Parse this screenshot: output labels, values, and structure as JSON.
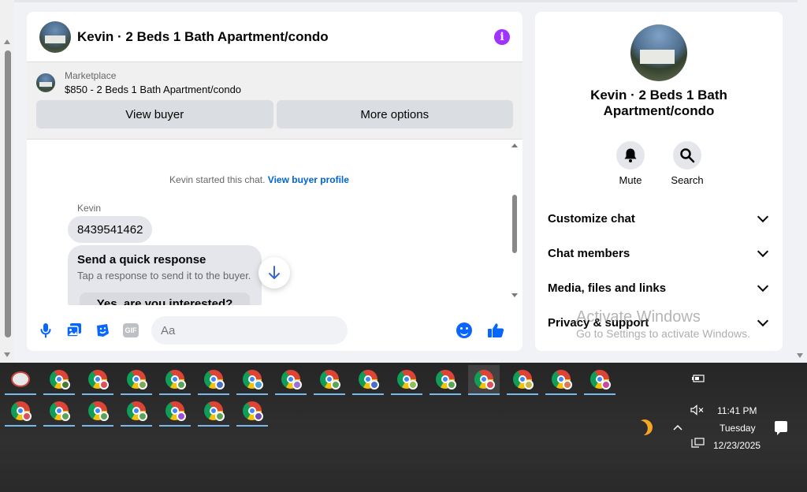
{
  "chat": {
    "title": "Kevin · 2 Beds 1 Bath Apartment/condo",
    "marketplace_label": "Marketplace",
    "listing": "$850 - 2 Beds 1 Bath Apartment/condo",
    "view_buyer": "View buyer",
    "more_options": "More options",
    "system_text": "Kevin started this chat.",
    "system_link": "View buyer profile",
    "sender": "Kevin",
    "phone_message": "8439541462",
    "quick_title": "Send a quick response",
    "quick_sub": "Tap a response to send it to the buyer.",
    "quick_option": "Yes, are you interested?",
    "input_placeholder": "Aa",
    "gif_label": "GIF"
  },
  "info": {
    "title": "Kevin · 2 Beds 1 Bath Apartment/condo",
    "mute": "Mute",
    "search": "Search",
    "sections": [
      "Customize chat",
      "Chat members",
      "Media, files and links",
      "Privacy & support"
    ]
  },
  "watermark": {
    "line1": "Activate Windows",
    "line2": "Go to Settings to activate Windows."
  },
  "taskbar": {
    "time": "11:41 PM",
    "day": "Tuesday",
    "date": "12/23/2025",
    "badge_colors": [
      "#6a4fb0",
      "#4a7a3a",
      "#d9505f",
      "#7fa85a",
      "#5aa35a",
      "#4b6fc8",
      "#4b9fd6",
      "#9b6fd6",
      "#5aa35a",
      "#4b6fc8",
      "#8fbf5a",
      "#5aa35a",
      "#d9505f",
      "#c8b84a",
      "#d97a50",
      "#c84a9f",
      "#d9505f",
      "#5aa35a",
      "#5aa35a",
      "#5aa35a",
      "#9b4fd6",
      "#5aa35a"
    ]
  },
  "colors": {
    "accent": "#0866ff",
    "info_icon": "#a033ff"
  }
}
